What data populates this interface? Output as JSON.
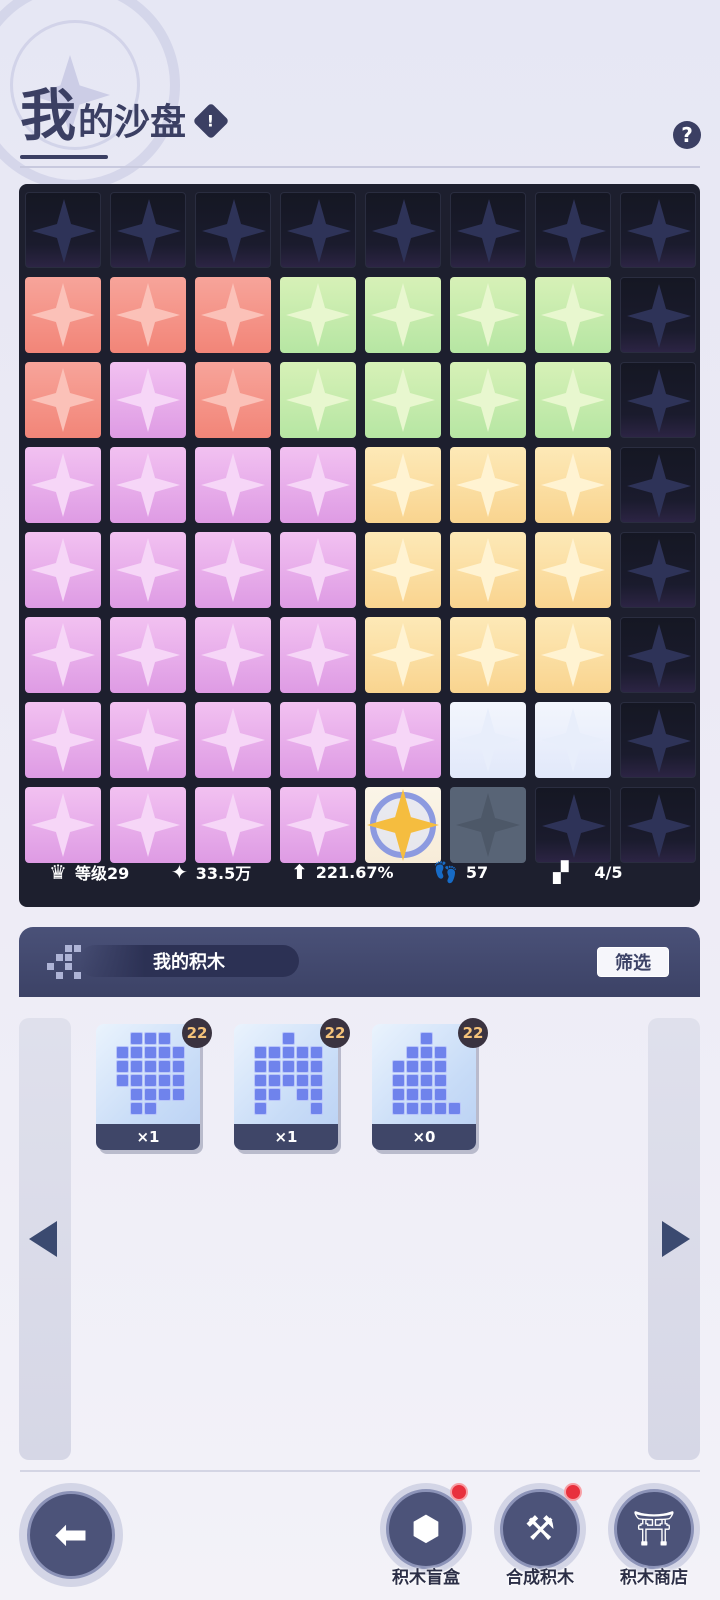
{
  "header": {
    "title_char": "我",
    "title_rest": "的沙盘",
    "warn_icon": "exclamation-diamond-icon",
    "warn_symbol": "!",
    "help_symbol": "?"
  },
  "board": {
    "rows": [
      [
        "dark",
        "dark",
        "dark",
        "dark",
        "dark",
        "dark",
        "dark",
        "dark"
      ],
      [
        "red",
        "red",
        "red",
        "green",
        "green",
        "green",
        "green",
        "dark"
      ],
      [
        "red",
        "purple",
        "red",
        "green",
        "green",
        "green",
        "green",
        "dark"
      ],
      [
        "purple",
        "purple",
        "purple",
        "purple",
        "yellow",
        "yellow",
        "yellow",
        "dark"
      ],
      [
        "purple",
        "purple",
        "purple",
        "purple",
        "yellow",
        "yellow",
        "yellow",
        "dark"
      ],
      [
        "purple",
        "purple",
        "purple",
        "purple",
        "yellow",
        "yellow",
        "yellow",
        "dark"
      ],
      [
        "purple",
        "purple",
        "purple",
        "purple",
        "purple",
        "white",
        "white",
        "dark"
      ],
      [
        "purple",
        "purple",
        "purple",
        "purple",
        "special",
        "gray",
        "dark",
        "dark"
      ]
    ],
    "stats": {
      "level": "等级29",
      "power": "33.5万",
      "bonus": "221.67%",
      "steps": "57",
      "blocks": "4/5"
    }
  },
  "panel": {
    "tab_label": "我的积木",
    "filter_label": "筛选"
  },
  "blocks": [
    {
      "badge": "22",
      "count": "×1",
      "shape": [
        [
          1,
          0
        ],
        [
          1,
          1
        ],
        [
          1,
          2
        ],
        [
          1,
          3
        ],
        [
          1,
          4
        ],
        [
          2,
          0
        ],
        [
          2,
          1
        ],
        [
          2,
          2
        ],
        [
          2,
          3
        ],
        [
          2,
          4
        ],
        [
          3,
          1
        ],
        [
          3,
          2
        ],
        [
          3,
          3
        ],
        [
          3,
          4
        ],
        [
          4,
          1
        ],
        [
          4,
          2
        ],
        [
          4,
          3
        ],
        [
          5,
          1
        ],
        [
          5,
          2
        ],
        [
          0,
          2
        ],
        [
          0,
          3
        ],
        [
          0,
          1
        ],
        [
          3,
          0
        ],
        [
          4,
          4
        ]
      ]
    },
    {
      "badge": "22",
      "count": "×1",
      "shape": [
        [
          0,
          2
        ],
        [
          1,
          0
        ],
        [
          1,
          1
        ],
        [
          1,
          2
        ],
        [
          1,
          3
        ],
        [
          1,
          4
        ],
        [
          2,
          0
        ],
        [
          2,
          1
        ],
        [
          2,
          2
        ],
        [
          2,
          3
        ],
        [
          2,
          4
        ],
        [
          3,
          0
        ],
        [
          3,
          1
        ],
        [
          3,
          2
        ],
        [
          3,
          3
        ],
        [
          3,
          4
        ],
        [
          4,
          0
        ],
        [
          4,
          1
        ],
        [
          4,
          3
        ],
        [
          4,
          4
        ],
        [
          5,
          0
        ],
        [
          5,
          4
        ]
      ]
    },
    {
      "badge": "22",
      "count": "×0",
      "shape": [
        [
          0,
          2
        ],
        [
          1,
          1
        ],
        [
          1,
          2
        ],
        [
          1,
          3
        ],
        [
          2,
          0
        ],
        [
          2,
          1
        ],
        [
          2,
          2
        ],
        [
          2,
          3
        ],
        [
          3,
          0
        ],
        [
          3,
          1
        ],
        [
          3,
          2
        ],
        [
          3,
          3
        ],
        [
          4,
          0
        ],
        [
          4,
          1
        ],
        [
          4,
          2
        ],
        [
          4,
          3
        ],
        [
          5,
          0
        ],
        [
          5,
          1
        ],
        [
          5,
          2
        ],
        [
          5,
          3
        ],
        [
          5,
          4
        ]
      ]
    }
  ],
  "nav": {
    "back_icon": "arrow-left-icon",
    "blind_box": "积木盲盒",
    "synthesize": "合成积木",
    "shop": "积木商店"
  }
}
